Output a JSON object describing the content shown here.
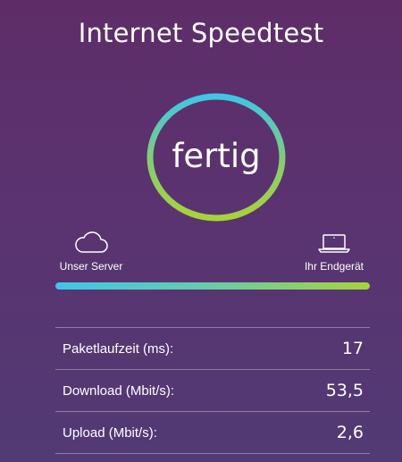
{
  "header": {
    "title": "Internet Speedtest"
  },
  "gauge": {
    "status": "fertig",
    "ring_colors": [
      "#3fc6e6",
      "#a8d23a"
    ]
  },
  "endpoints": {
    "server": {
      "label": "Unser Server",
      "icon": "cloud-icon"
    },
    "device": {
      "label": "Ihr Endgerät",
      "icon": "laptop-icon"
    }
  },
  "progress": {
    "fraction": 1.0,
    "colors": [
      "#40c6e8",
      "#a6d23c"
    ]
  },
  "results": [
    {
      "label": "Paketlaufzeit (ms):",
      "value": "17"
    },
    {
      "label": "Download (Mbit/s):",
      "value": "53,5"
    },
    {
      "label": "Upload (Mbit/s):",
      "value": "2,6"
    }
  ]
}
